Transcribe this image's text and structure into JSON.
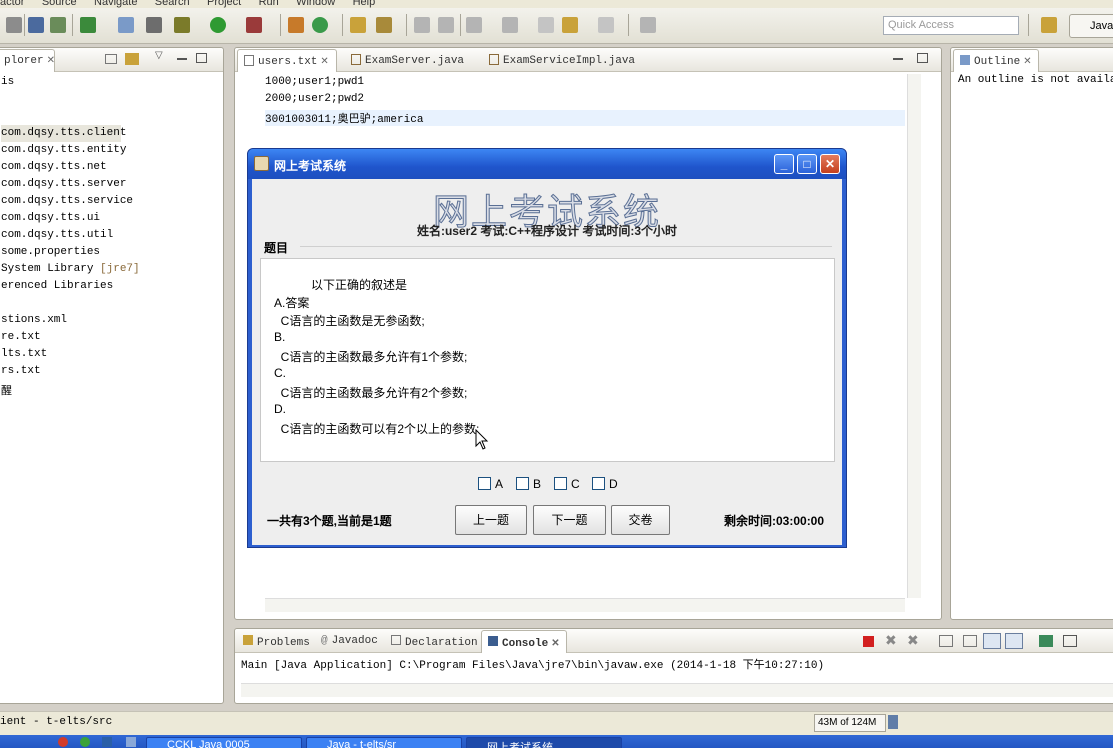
{
  "menubar": {
    "items": [
      "actor",
      "Source",
      "Navigate",
      "Search",
      "Project",
      "Run",
      "Window",
      "Help"
    ]
  },
  "toolbar": {
    "quick_access_placeholder": "Quick Access",
    "perspective_label": "Java"
  },
  "explorer": {
    "tab_label": "plorer",
    "rows": [
      {
        "text": "is",
        "selected": false
      },
      {
        "text": "com.dqsy.tts.client",
        "selected": true
      },
      {
        "text": "com.dqsy.tts.entity",
        "selected": false
      },
      {
        "text": "com.dqsy.tts.net",
        "selected": false
      },
      {
        "text": "com.dqsy.tts.server",
        "selected": false
      },
      {
        "text": "com.dqsy.tts.service",
        "selected": false
      },
      {
        "text": "com.dqsy.tts.ui",
        "selected": false
      },
      {
        "text": "com.dqsy.tts.util",
        "selected": false
      },
      {
        "text": "some.properties",
        "selected": false
      },
      {
        "text": " System Library ",
        "suffix": "[jre7]",
        "selected": false
      },
      {
        "text": "erenced Libraries",
        "selected": false
      },
      {
        "text": "stions.xml",
        "selected": false
      },
      {
        "text": "re.txt",
        "selected": false
      },
      {
        "text": "lts.txt",
        "selected": false
      },
      {
        "text": "rs.txt",
        "selected": false
      },
      {
        "text": "醒",
        "selected": false
      }
    ]
  },
  "editor": {
    "tabs": [
      {
        "label": "users.txt",
        "active": true
      },
      {
        "label": "ExamServer.java",
        "active": false
      },
      {
        "label": "ExamServiceImpl.java",
        "active": false
      }
    ],
    "lines": [
      "1000;user1;pwd1",
      "2000;user2;pwd2",
      "3001003011;奥巴驴;america"
    ]
  },
  "outline": {
    "tab_label": "Outline",
    "message": "An outline is not availabl"
  },
  "console": {
    "tabs": [
      "Problems",
      "Javadoc",
      "Declaration",
      "Console"
    ],
    "launch_line": "Main [Java Application] C:\\Program Files\\Java\\jre7\\bin\\javaw.exe (2014-1-18 下午10:27:10)"
  },
  "dialog": {
    "window_title": "网上考试系统",
    "big_title": "网上考试系统",
    "info": "姓名:user2   考试:C++程序设计   考试时间:3个小时",
    "group_label": "题目",
    "question": {
      "stem": "以下正确的叙述是",
      "lines": [
        "A.答案",
        "  C语言的主函数是无参函数;",
        "B.",
        "  C语言的主函数最多允许有1个参数;",
        "C.",
        "  C语言的主函数最多允许有2个参数;",
        "D.",
        "  C语言的主函数可以有2个以上的参数;"
      ]
    },
    "checkboxes": [
      "A",
      "B",
      "C",
      "D"
    ],
    "count_text": "一共有3个题,当前是1题",
    "buttons": {
      "prev": "上一题",
      "next": "下一题",
      "submit": "交卷"
    },
    "remaining_text": "剩余时间:03:00:00"
  },
  "status": {
    "left_text": "ient - t-elts/src",
    "heap": "43M of 124M"
  },
  "taskbar": {
    "items": [
      "CCKL Java 0005",
      "Java - t-elts/sr",
      "网上考试系统"
    ]
  }
}
